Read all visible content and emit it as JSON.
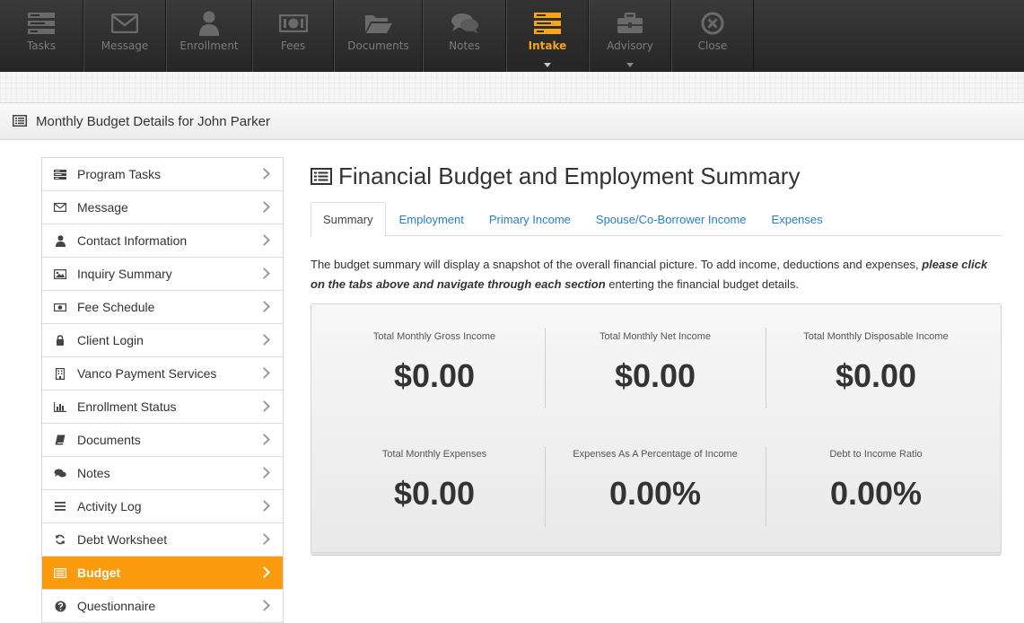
{
  "toolbar": {
    "items": [
      {
        "label": "Tasks",
        "icon": "tasks-icon",
        "active": false,
        "caret": false
      },
      {
        "label": "Message",
        "icon": "envelope-icon",
        "active": false,
        "caret": false
      },
      {
        "label": "Enrollment",
        "icon": "user-icon",
        "active": false,
        "caret": false
      },
      {
        "label": "Fees",
        "icon": "money-icon",
        "active": false,
        "caret": false
      },
      {
        "label": "Documents",
        "icon": "folder-open-icon",
        "active": false,
        "caret": false
      },
      {
        "label": "Notes",
        "icon": "comments-icon",
        "active": false,
        "caret": false
      },
      {
        "label": "Intake",
        "icon": "tasks-icon",
        "active": true,
        "caret": true
      },
      {
        "label": "Advisory",
        "icon": "briefcase-icon",
        "active": false,
        "caret": true
      },
      {
        "label": "Close",
        "icon": "close-circle-icon",
        "active": false,
        "caret": false
      }
    ]
  },
  "panel": {
    "title": "Monthly Budget Details for John Parker",
    "icon": "list-alt-icon"
  },
  "sidebar": {
    "items": [
      {
        "label": "Program Tasks",
        "icon": "tasks-icon",
        "active": false
      },
      {
        "label": "Message",
        "icon": "envelope-icon",
        "active": false
      },
      {
        "label": "Contact Information",
        "icon": "user-icon",
        "active": false
      },
      {
        "label": "Inquiry Summary",
        "icon": "picture-icon",
        "active": false
      },
      {
        "label": "Fee Schedule",
        "icon": "money-icon",
        "active": false
      },
      {
        "label": "Client Login",
        "icon": "lock-icon",
        "active": false
      },
      {
        "label": "Vanco Payment Services",
        "icon": "building-icon",
        "active": false
      },
      {
        "label": "Enrollment Status",
        "icon": "bar-chart-icon",
        "active": false
      },
      {
        "label": "Documents",
        "icon": "book-icon",
        "active": false
      },
      {
        "label": "Notes",
        "icon": "comments-icon",
        "active": false
      },
      {
        "label": "Activity Log",
        "icon": "list-icon",
        "active": false
      },
      {
        "label": "Debt Worksheet",
        "icon": "refresh-icon",
        "active": false
      },
      {
        "label": "Budget",
        "icon": "list-alt-icon",
        "active": true
      },
      {
        "label": "Questionnaire",
        "icon": "question-circle-icon",
        "active": false
      }
    ]
  },
  "main": {
    "heading": "Financial Budget and Employment Summary",
    "tabs": [
      {
        "label": "Summary",
        "active": true
      },
      {
        "label": "Employment",
        "active": false
      },
      {
        "label": "Primary Income",
        "active": false
      },
      {
        "label": "Spouse/Co-Borrower Income",
        "active": false
      },
      {
        "label": "Expenses",
        "active": false
      }
    ],
    "description": {
      "part1": "The budget summary will display a snapshot of the overall financial picture. To add income, deductions and expenses, ",
      "emphasis": "please click on the tabs above and navigate through each section",
      "part2": " enterting the financial budget details."
    },
    "stats": [
      {
        "label": "Total Monthly Gross Income",
        "value": "$0.00"
      },
      {
        "label": "Total Monthly Net Income",
        "value": "$0.00"
      },
      {
        "label": "Total Monthly Disposable Income",
        "value": "$0.00"
      },
      {
        "label": "Total Monthly Expenses",
        "value": "$0.00"
      },
      {
        "label": "Expenses As A Percentage of Income",
        "value": "0.00%"
      },
      {
        "label": "Debt to Income Ratio",
        "value": "0.00%"
      }
    ]
  },
  "colors": {
    "accent": "#f99b0c",
    "toolbar_active": "#f7a51c",
    "link": "#2a7dc4"
  }
}
